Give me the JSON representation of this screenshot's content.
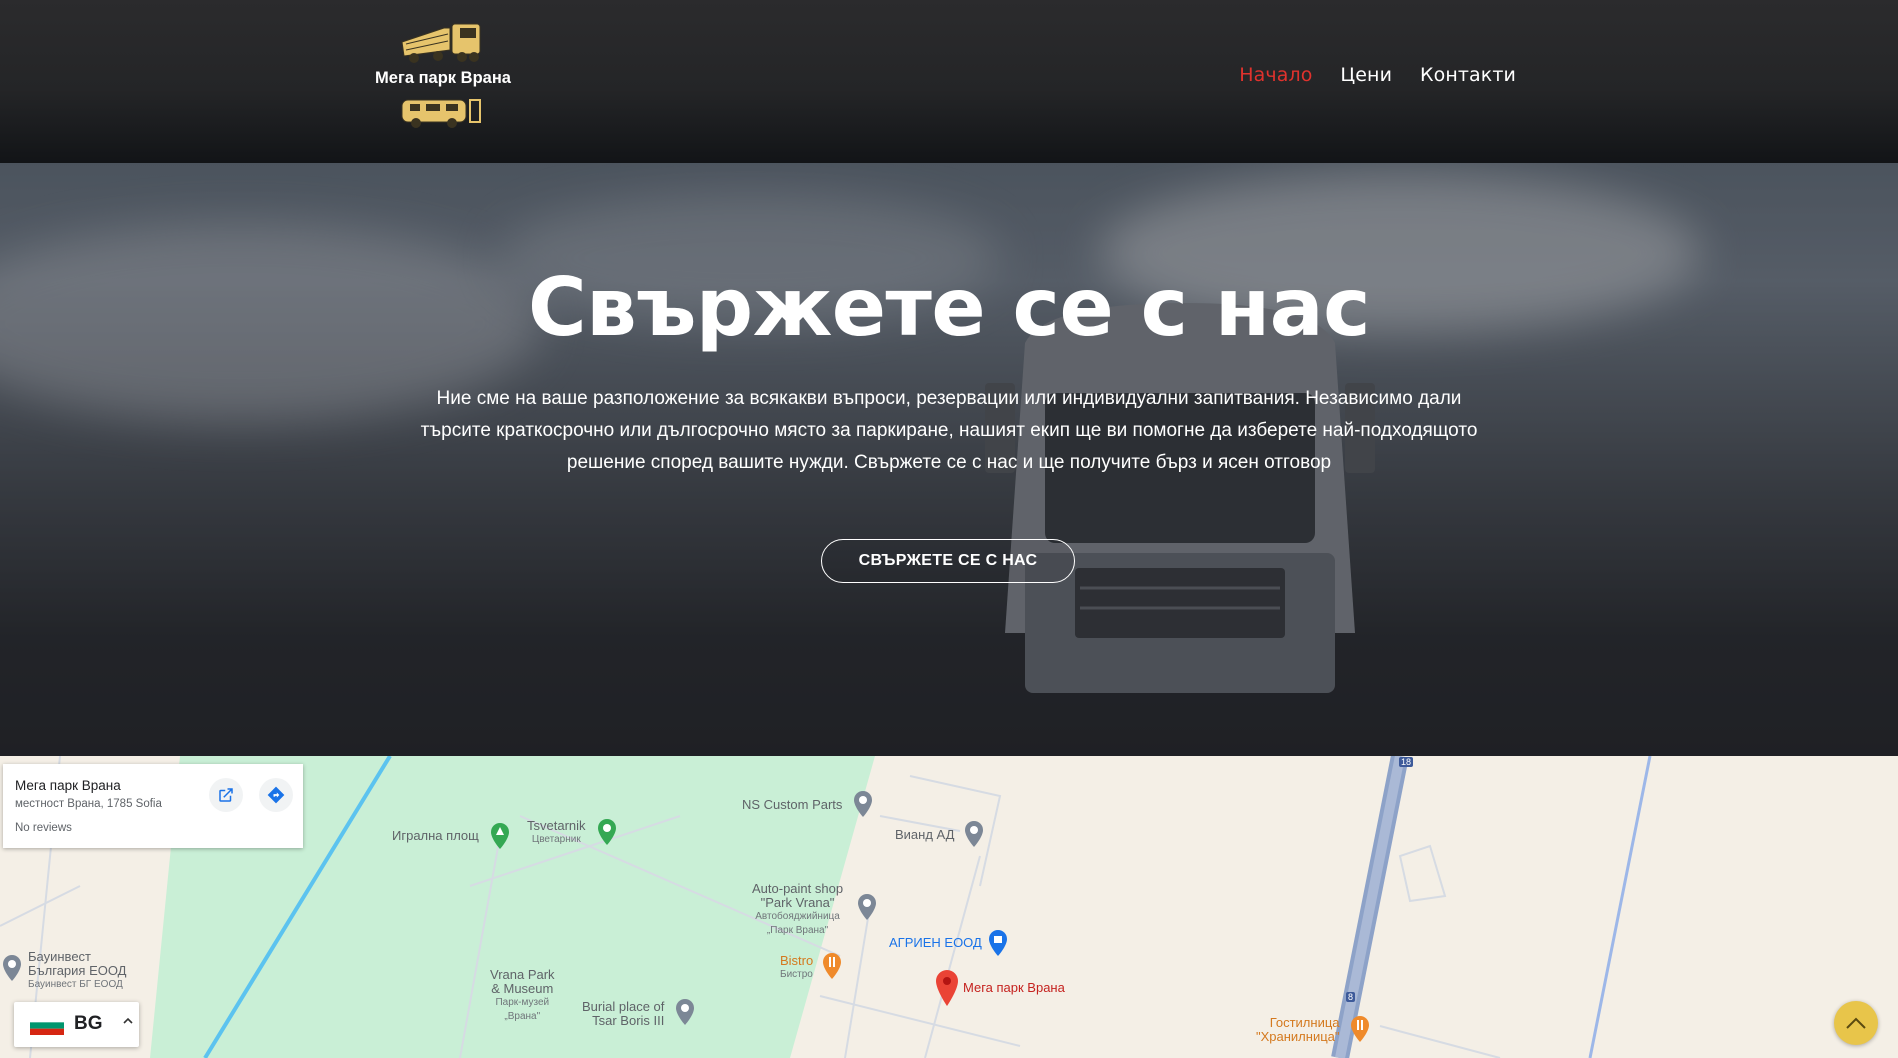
{
  "header": {
    "logo_text": "Мега парк Врана",
    "nav": [
      {
        "label": "Начало",
        "active": true
      },
      {
        "label": "Цени",
        "active": false
      },
      {
        "label": "Контакти",
        "active": false
      }
    ],
    "active_color": "#e0322d"
  },
  "hero": {
    "title": "Свържете се с нас",
    "text": "Ние сме на ваше разположение за всякакви въпроси, резервации или индивидуални запитвания. Независимо дали търсите краткосрочно или дългосрочно място за паркиране, нашият екип ще ви помогне да изберете най-подходящото решение според вашите нужди. Свържете се с нас и ще получите бърз и ясен отговор",
    "button_label": "СВЪРЖЕТЕ СЕ С НАС"
  },
  "map": {
    "card": {
      "name": "Мега парк Врана",
      "address": "местност Врана, 1785 Sofia",
      "reviews": "No reviews",
      "icons": [
        "open-in-maps-icon",
        "directions-icon"
      ]
    },
    "places": {
      "ns_custom": "NS Custom Parts",
      "viand": "Виaнд АД",
      "tsvetarnik": "Tsvetarnik",
      "tsvetarnik_sub": "Цветарник",
      "playground": "Игрална площ",
      "autopaint_1": "Auto-paint shop",
      "autopaint_2": "\"Park Vrana\"",
      "autopaint_sub1": "Автобояджийница",
      "autopaint_sub2": "„Парк Врана\"",
      "agrien": "АГРИЕН ЕООД",
      "bistro": "Bistro",
      "bistro_sub": "Бистро",
      "megapark": "Мега парк Врана",
      "bauinvest_1": "Бауинвест",
      "bauinvest_2": "България ЕООД",
      "bauinvest_sub": "Бауинвест БГ ЕООД",
      "vrana_1": "Vrana Park",
      "vrana_2": "& Museum",
      "vrana_sub1": "Парк-музей",
      "vrana_sub2": "„Врана\"",
      "burial_1": "Burial place of",
      "burial_2": "Tsar Boris III",
      "hotel_1": "Гостилница",
      "hotel_2": "\"Хранилница\"",
      "road_18": "18",
      "road_8": "8"
    }
  },
  "language": {
    "code": "BG",
    "flag": "bulgaria-flag"
  },
  "scroll_top_icon": "chevron-up-icon"
}
